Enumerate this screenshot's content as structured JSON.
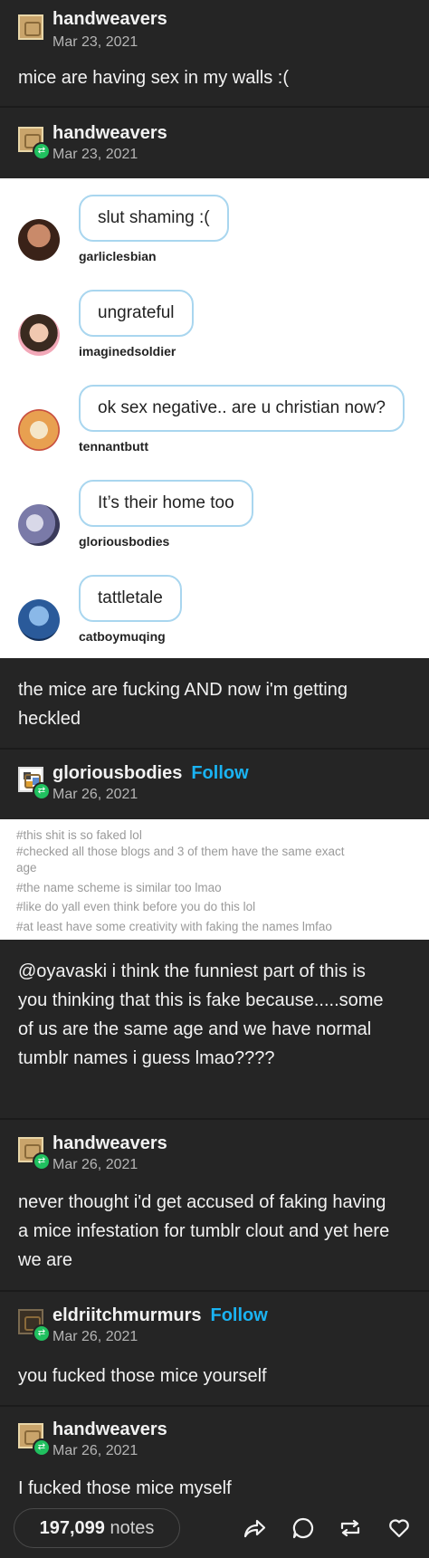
{
  "posts": [
    {
      "user": "handweavers",
      "date": "Mar 23, 2021",
      "text": "mice are having sex in my walls :("
    },
    {
      "user": "handweavers",
      "date": "Mar 23, 2021",
      "text": "the mice are fucking AND now i'm getting heckled"
    },
    {
      "user": "gloriousbodies",
      "follow": "Follow",
      "date": "Mar 26, 2021",
      "text": "@oyavaski i think the funniest part of this is you thinking that this is fake because.....some of us are the same age and we have normal tumblr names i guess lmao????"
    },
    {
      "user": "handweavers",
      "date": "Mar 26, 2021",
      "text": "never thought i'd get accused of faking having a mice infestation for tumblr clout and yet here we are"
    },
    {
      "user": "eldriitchmurmurs",
      "follow": "Follow",
      "date": "Mar 26, 2021",
      "text": "you fucked those mice yourself"
    },
    {
      "user": "handweavers",
      "date": "Mar 26, 2021",
      "text": "I fucked those mice myself"
    }
  ],
  "chat": [
    {
      "text": "slut shaming :(",
      "user": "garliclesbian",
      "avatar_color": "#5a3a2a"
    },
    {
      "text": "ungrateful",
      "user": "imaginedsoldier",
      "avatar_color": "#e8a0a8"
    },
    {
      "text": "ok sex negative.. are u christian now?",
      "user": "tennantbutt",
      "avatar_color": "#e8b070"
    },
    {
      "text": "It’s their home too",
      "user": "gloriousbodies",
      "avatar_color": "#6a6a9a"
    },
    {
      "text": "tattletale",
      "user": "catboymuqing",
      "avatar_color": "#2a5a9a"
    }
  ],
  "tags": [
    "#this shit is so faked lol",
    "#checked all those blogs and 3 of them have the same exact",
    "age",
    "#the name scheme is similar too lmao",
    "#like do yall even think before you do this lol",
    "#at least have some creativity with faking the names lmfao"
  ],
  "footer": {
    "notes_count": "197,099",
    "notes_label": "notes"
  },
  "icons": [
    "share-icon",
    "reply-icon",
    "reblog-icon",
    "like-icon"
  ],
  "colors": {
    "background": "#252525",
    "follow": "#1ab3f2",
    "reblog_badge": "#20c05f",
    "bubble_border": "#a9d6ef"
  }
}
